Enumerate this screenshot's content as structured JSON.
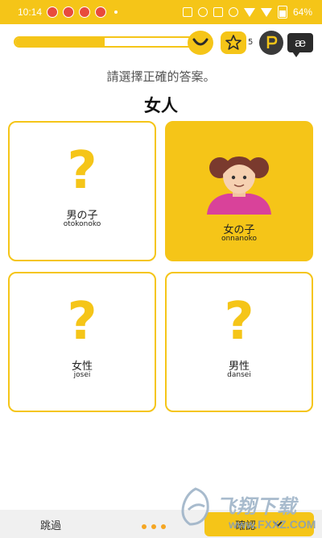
{
  "status_bar": {
    "time": "10:14",
    "battery": "64%",
    "notification_icons": [
      "notif-icon",
      "notif-icon",
      "notif-icon",
      "notif-icon"
    ],
    "right_icons": [
      "image-icon",
      "alarm-icon",
      "sim-icon",
      "mute-icon",
      "wifi-icon",
      "signal-icon",
      "battery-icon"
    ]
  },
  "toolbar": {
    "progress": 0.5,
    "star_count": "5",
    "lang_label": "æ",
    "coin_label": "P"
  },
  "prompt": {
    "instruction": "請選擇正確的答案。",
    "question": "女人"
  },
  "options": [
    {
      "word": "男の子",
      "romaji": "otokonoko",
      "selected": false
    },
    {
      "word": "女の子",
      "romaji": "onnanoko",
      "selected": true
    },
    {
      "word": "女性",
      "romaji": "josei",
      "selected": false
    },
    {
      "word": "男性",
      "romaji": "dansei",
      "selected": false
    }
  ],
  "bottom": {
    "skip_label": "跳過",
    "check_label": "確認"
  },
  "watermark": {
    "brand": "飞翔下载",
    "url": "www.FXXZ.COM"
  },
  "colors": {
    "accent": "#f5c518",
    "dots": "#f5a623"
  }
}
